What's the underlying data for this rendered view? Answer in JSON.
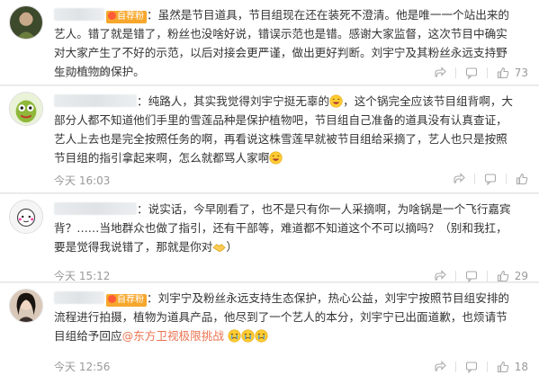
{
  "comments": [
    {
      "badge": "自荐粉",
      "text": "：虽然是节目道具，节目组现在还在装死不澄清。他是唯一一个站出来的艺人。错了就是错了，粉丝也没啥好说，错误示范也是错。感谢大家监督，这次节目中确实对大家产生了不好的示范，以后对接会更严谨，做出更好判断。刘宇宁及其粉丝永远支持野生动植物的保护。",
      "time": "今天 13:04",
      "likes": "73"
    },
    {
      "badge": "",
      "text_a": "：纯路人，其实我觉得刘宇宁挺无辜的",
      "text_b": "，这个锅完全应该节目组背啊，大部分人都不知道他们手里的雪莲品种是保护植物吧，节目组自己准备的道具没有认真查证，艺人上去也是完全按照任务的啊，再看说这株雪莲早就被节目组给采摘了，艺人也只是按照节目组的指引拿起来啊，怎么就都骂人家啊",
      "time": "今天 16:03",
      "likes": ""
    },
    {
      "badge": "",
      "text_a": "：说实话，今早刚看了，也不是只有你一人采摘啊，为啥锅是一个飞行嘉宾背？……当地群众也做了指引，还有干部等，难道都不知道这个不可以摘吗？（别和我扛，要是觉得我说错了，那就是你对",
      "text_b": "）",
      "time": "今天 15:12",
      "likes": "29"
    },
    {
      "badge": "自荐粉",
      "text_a": "：刘宇宁及粉丝永远支持生态保护，热心公益，刘宇宁按照节目组安排的流程进行拍摄，植物为道具产品，他尽到了一个艺人的本分，刘宇宁已出面道歉，也烦请节目组给予回应",
      "mention": "@东方卫视极限挑战",
      "time": "今天 12:56",
      "likes": "18"
    }
  ],
  "icons": {
    "share": "share-icon",
    "comment": "comment-icon",
    "like": "like-icon"
  },
  "colors": {
    "badge": "#f6a72c",
    "link": "#eb7350",
    "meta": "#999999"
  }
}
